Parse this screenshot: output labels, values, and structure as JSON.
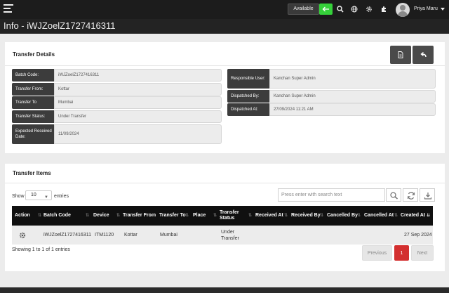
{
  "topbar": {
    "availability_label": "Available",
    "user_name": "Priya Maru"
  },
  "page": {
    "title": "Info - iWJZoelZ1727416311"
  },
  "transfer_details": {
    "title": "Transfer Details",
    "left_fields": [
      {
        "label": "Batch Code:",
        "value": "iWJZoelZ1727416311"
      },
      {
        "label": "Transfer From:",
        "value": "Kottar"
      },
      {
        "label": "Transfer To",
        "value": "Mumbai"
      },
      {
        "label": "Transfer Status:",
        "value": "Under Transfer"
      },
      {
        "label": "Expected Received Date:",
        "value": "11/09/2024"
      }
    ],
    "right_fields": [
      {
        "label": "Responsible User:",
        "value": "Kanchan Super Admin"
      },
      {
        "label": "Dispatched By:",
        "value": "Kanchan Super Admin"
      },
      {
        "label": "Dispatched At:",
        "value": "27/09/2024 11:21 AM"
      }
    ]
  },
  "transfer_items": {
    "title": "Transfer Items",
    "show_label": "Show",
    "entries_value": "10",
    "entries_label": "entries",
    "search_placeholder": "Press enter with search text",
    "columns": [
      "Action",
      "Batch Code",
      "Device",
      "Transfer From",
      "Transfer To",
      "Place",
      "Transfer Status",
      "Received At",
      "Received By",
      "Cancelled By",
      "Cancelled At",
      "Created At"
    ],
    "rows": [
      {
        "batch_code": "iWJZoelZ1727416311",
        "device": "ITM1120",
        "transfer_from": "Kottar",
        "transfer_to": "Mumbai",
        "place": "",
        "transfer_status": "Under Transfer",
        "received_at": "",
        "received_by": "",
        "cancelled_by": "",
        "cancelled_at": "",
        "created_at": "27 Sep 2024"
      }
    ],
    "info": "Showing 1 to 1 of 1 entries",
    "pagination": {
      "previous": "Previous",
      "current": "1",
      "next": "Next"
    }
  },
  "colors": {
    "topbar": "#1c1c1c",
    "available_toggle": "#35d13a",
    "table_header": "#101010",
    "active_page": "#d32f2f"
  }
}
